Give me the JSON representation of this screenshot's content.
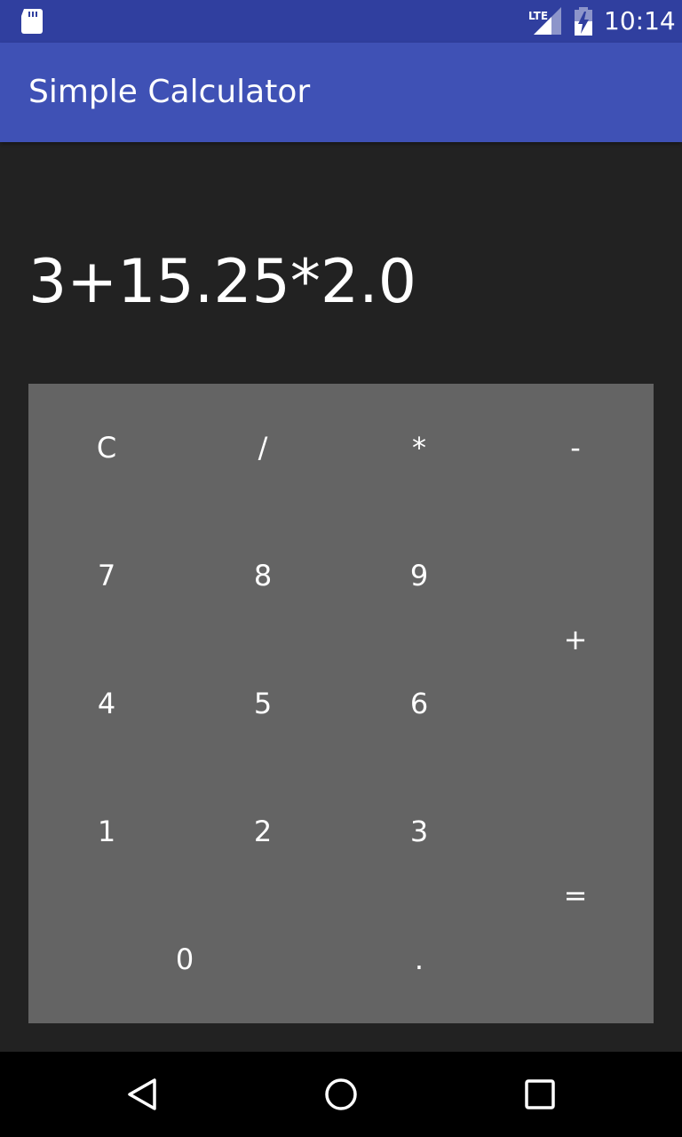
{
  "status_bar": {
    "time": "10:14",
    "network_label": "LTE",
    "icons": [
      "sd-card-icon",
      "signal-icon",
      "battery-charging-icon"
    ]
  },
  "app_bar": {
    "title": "Simple Calculator"
  },
  "display": {
    "expression": "3+15.25*2.0"
  },
  "keypad": {
    "clear": "C",
    "divide": "/",
    "multiply": "*",
    "minus": "-",
    "seven": "7",
    "eight": "8",
    "nine": "9",
    "plus": "+",
    "four": "4",
    "five": "5",
    "six": "6",
    "one": "1",
    "two": "2",
    "three": "3",
    "equals": "=",
    "zero": "0",
    "dot": "."
  },
  "nav_bar": {
    "icons": [
      "back-icon",
      "home-icon",
      "recents-icon"
    ]
  },
  "colors": {
    "status_bar": "#303f9f",
    "app_bar": "#3f51b5",
    "background": "#222222",
    "keypad": "#646464",
    "text": "#ffffff"
  }
}
